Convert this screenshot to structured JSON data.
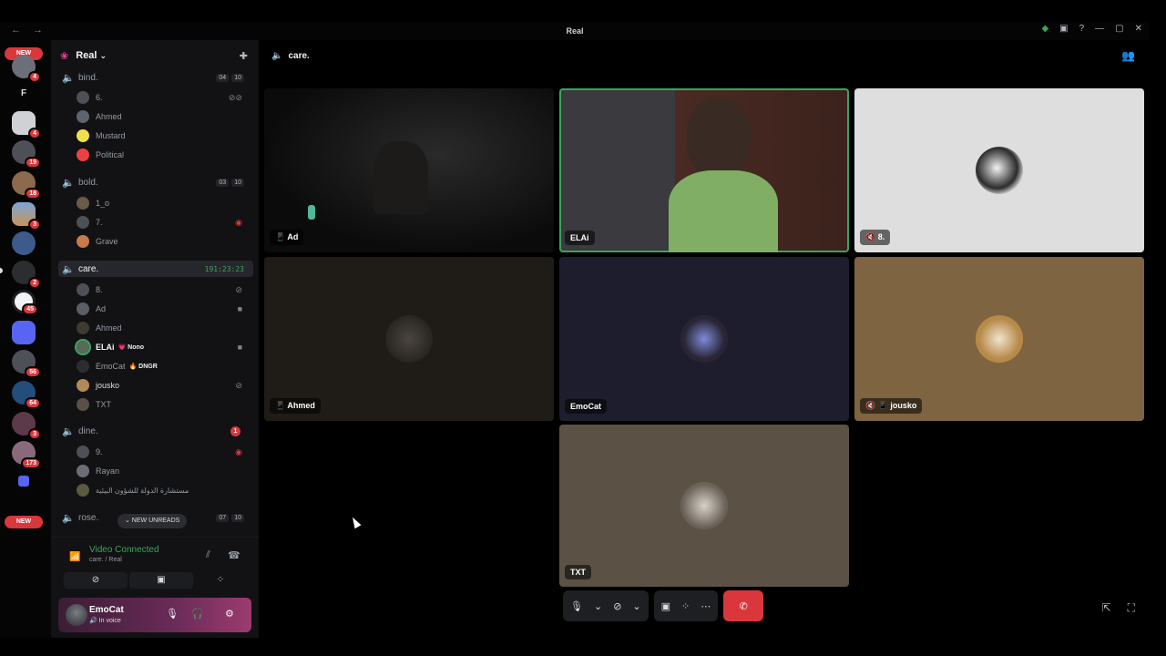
{
  "window": {
    "title": "Real",
    "nav_icons": "← →",
    "controls": [
      "◆",
      "▣",
      "?",
      "—",
      "▢",
      "✕"
    ]
  },
  "servers": {
    "new_top": "NEW",
    "new_bottom": "NEW",
    "letter": "F",
    "badges": [
      "4",
      "19",
      "18",
      "3",
      "2",
      "45",
      "56",
      "64",
      "3",
      "173"
    ]
  },
  "guild": {
    "name": "Real",
    "chevron": "⌄",
    "invite_icon": "✚"
  },
  "channels": {
    "bind": {
      "name": "bind.",
      "count": "04",
      "limit": "10",
      "users": [
        "6.",
        "Ahmed",
        "Mustard",
        "Political"
      ]
    },
    "bold": {
      "name": "bold.",
      "count": "03",
      "limit": "10",
      "users": [
        "1_o",
        "7.",
        "Grave"
      ]
    },
    "care": {
      "name": "care.",
      "timer": "191:23:23",
      "users": [
        "8.",
        "Ad",
        "Ahmed",
        "ELAi",
        "EmoCat",
        "jousko",
        "TXT"
      ],
      "elai_tag": "💗 Nono",
      "emocat_tag": "🔥 DNGR"
    },
    "dine": {
      "name": "dine.",
      "badge": "1",
      "users": [
        "9.",
        "Rayan",
        "مستشارة الدولة للشؤون البيئية"
      ]
    },
    "rose": {
      "name": "rose.",
      "count": "07",
      "limit": "10"
    }
  },
  "new_unreads": "⌄ NEW UNREADS",
  "voice_panel": {
    "title": "Video Connected",
    "subtitle": "care. / Real",
    "btn_video": "⊘",
    "btn_share": "▣",
    "btn_activity": "⁘"
  },
  "user_panel": {
    "name": "EmoCat",
    "status": "🔊 In voice",
    "mic": "🎙",
    "headset": "🎧",
    "settings": "⚙"
  },
  "main": {
    "channel": "care.",
    "people_icon": "👥"
  },
  "tiles": [
    {
      "label": "📱 Ad"
    },
    {
      "label": "ELAi"
    },
    {
      "label": "🔇 8."
    },
    {
      "label": "📱 Ahmed"
    },
    {
      "label": "EmoCat"
    },
    {
      "label": "🔇 📱 jousko"
    },
    {
      "label": "TXT"
    }
  ],
  "controls": {
    "mic": "🎙",
    "chev": "⌄",
    "camera": "⊘",
    "share": "▣",
    "activity": "⁘",
    "more": "⋯",
    "hangup": "✆"
  },
  "right_controls": {
    "popout": "⇱",
    "fullscreen": "⛶"
  },
  "colors": {
    "accent": "#3ba55c",
    "danger": "#da373c",
    "bg": "#000000",
    "sidebar": "#121214"
  }
}
